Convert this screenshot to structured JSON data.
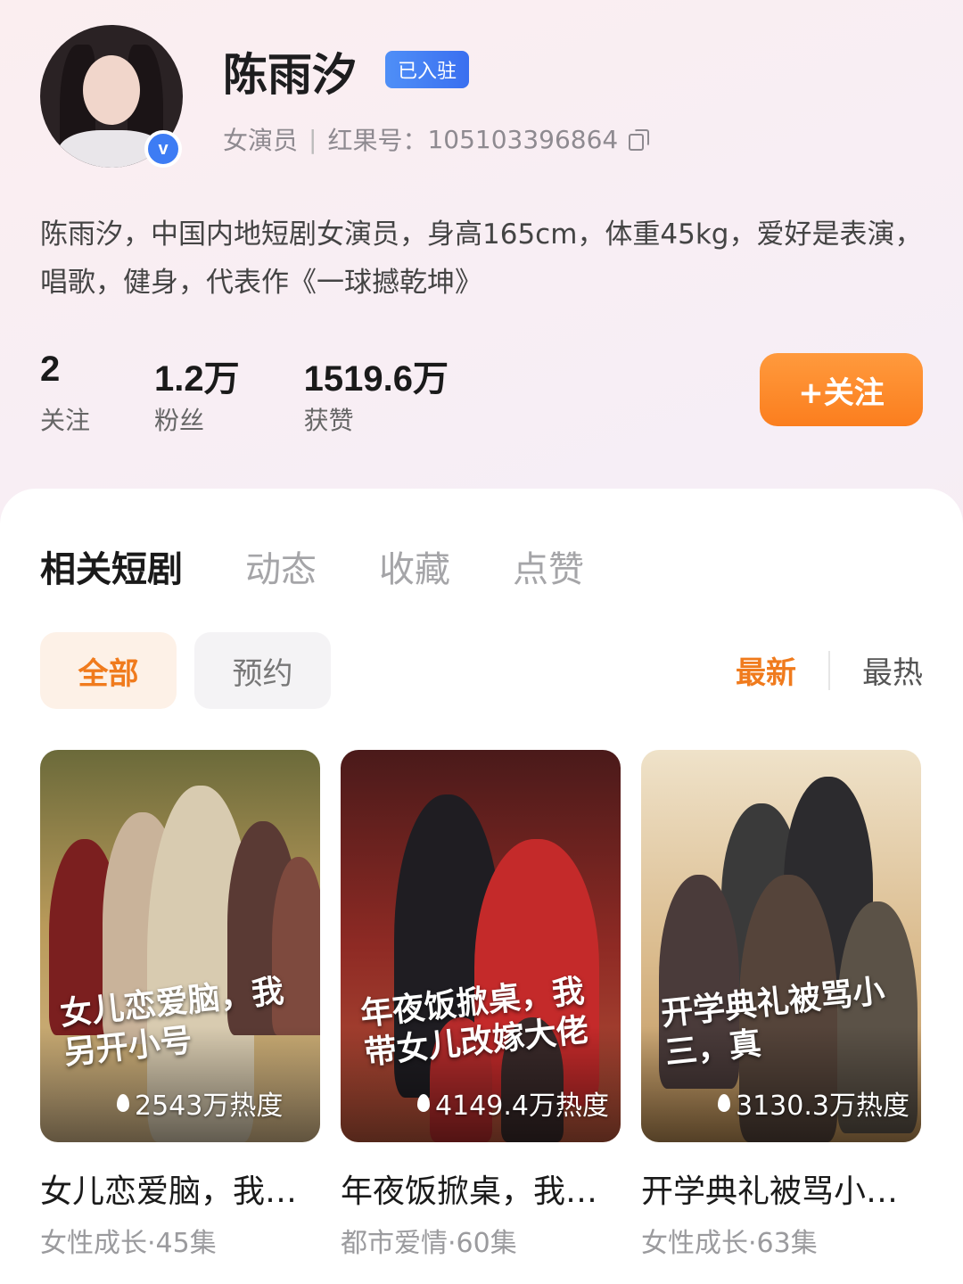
{
  "profile": {
    "name": "陈雨汐",
    "tag": "已入驻",
    "role": "女演员",
    "id_label": "红果号：",
    "id_value": "105103396864",
    "verified_mark": "v",
    "bio": "陈雨汐，中国内地短剧女演员，身高165cm，体重45kg，爱好是表演，唱歌，健身，代表作《一球撼乾坤》"
  },
  "stats": [
    {
      "value": "2",
      "label": "关注"
    },
    {
      "value": "1.2万",
      "label": "粉丝"
    },
    {
      "value": "1519.6万",
      "label": "获赞"
    }
  ],
  "follow_button": "+关注",
  "tabs": [
    "相关短剧",
    "动态",
    "收藏",
    "点赞"
  ],
  "filters": {
    "all": "全部",
    "reserved": "预约"
  },
  "sort": {
    "latest": "最新",
    "hottest": "最热"
  },
  "cards": [
    {
      "poster_text": "女儿恋爱脑，我另开小号",
      "heat": "2543万热度",
      "title": "女儿恋爱脑，我…",
      "meta": "女性成长·45集",
      "bg": "#b99a5a"
    },
    {
      "poster_text": "年夜饭掀桌，我带女儿改嫁大佬",
      "heat": "4149.4万热度",
      "title": "年夜饭掀桌，我…",
      "meta": "都市爱情·60集",
      "bg": "#8e2a24"
    },
    {
      "poster_text": "开学典礼被骂小三，真",
      "heat": "3130.3万热度",
      "title": "开学典礼被骂小…",
      "meta": "女性成长·63集",
      "bg": "#d9b98a"
    }
  ]
}
